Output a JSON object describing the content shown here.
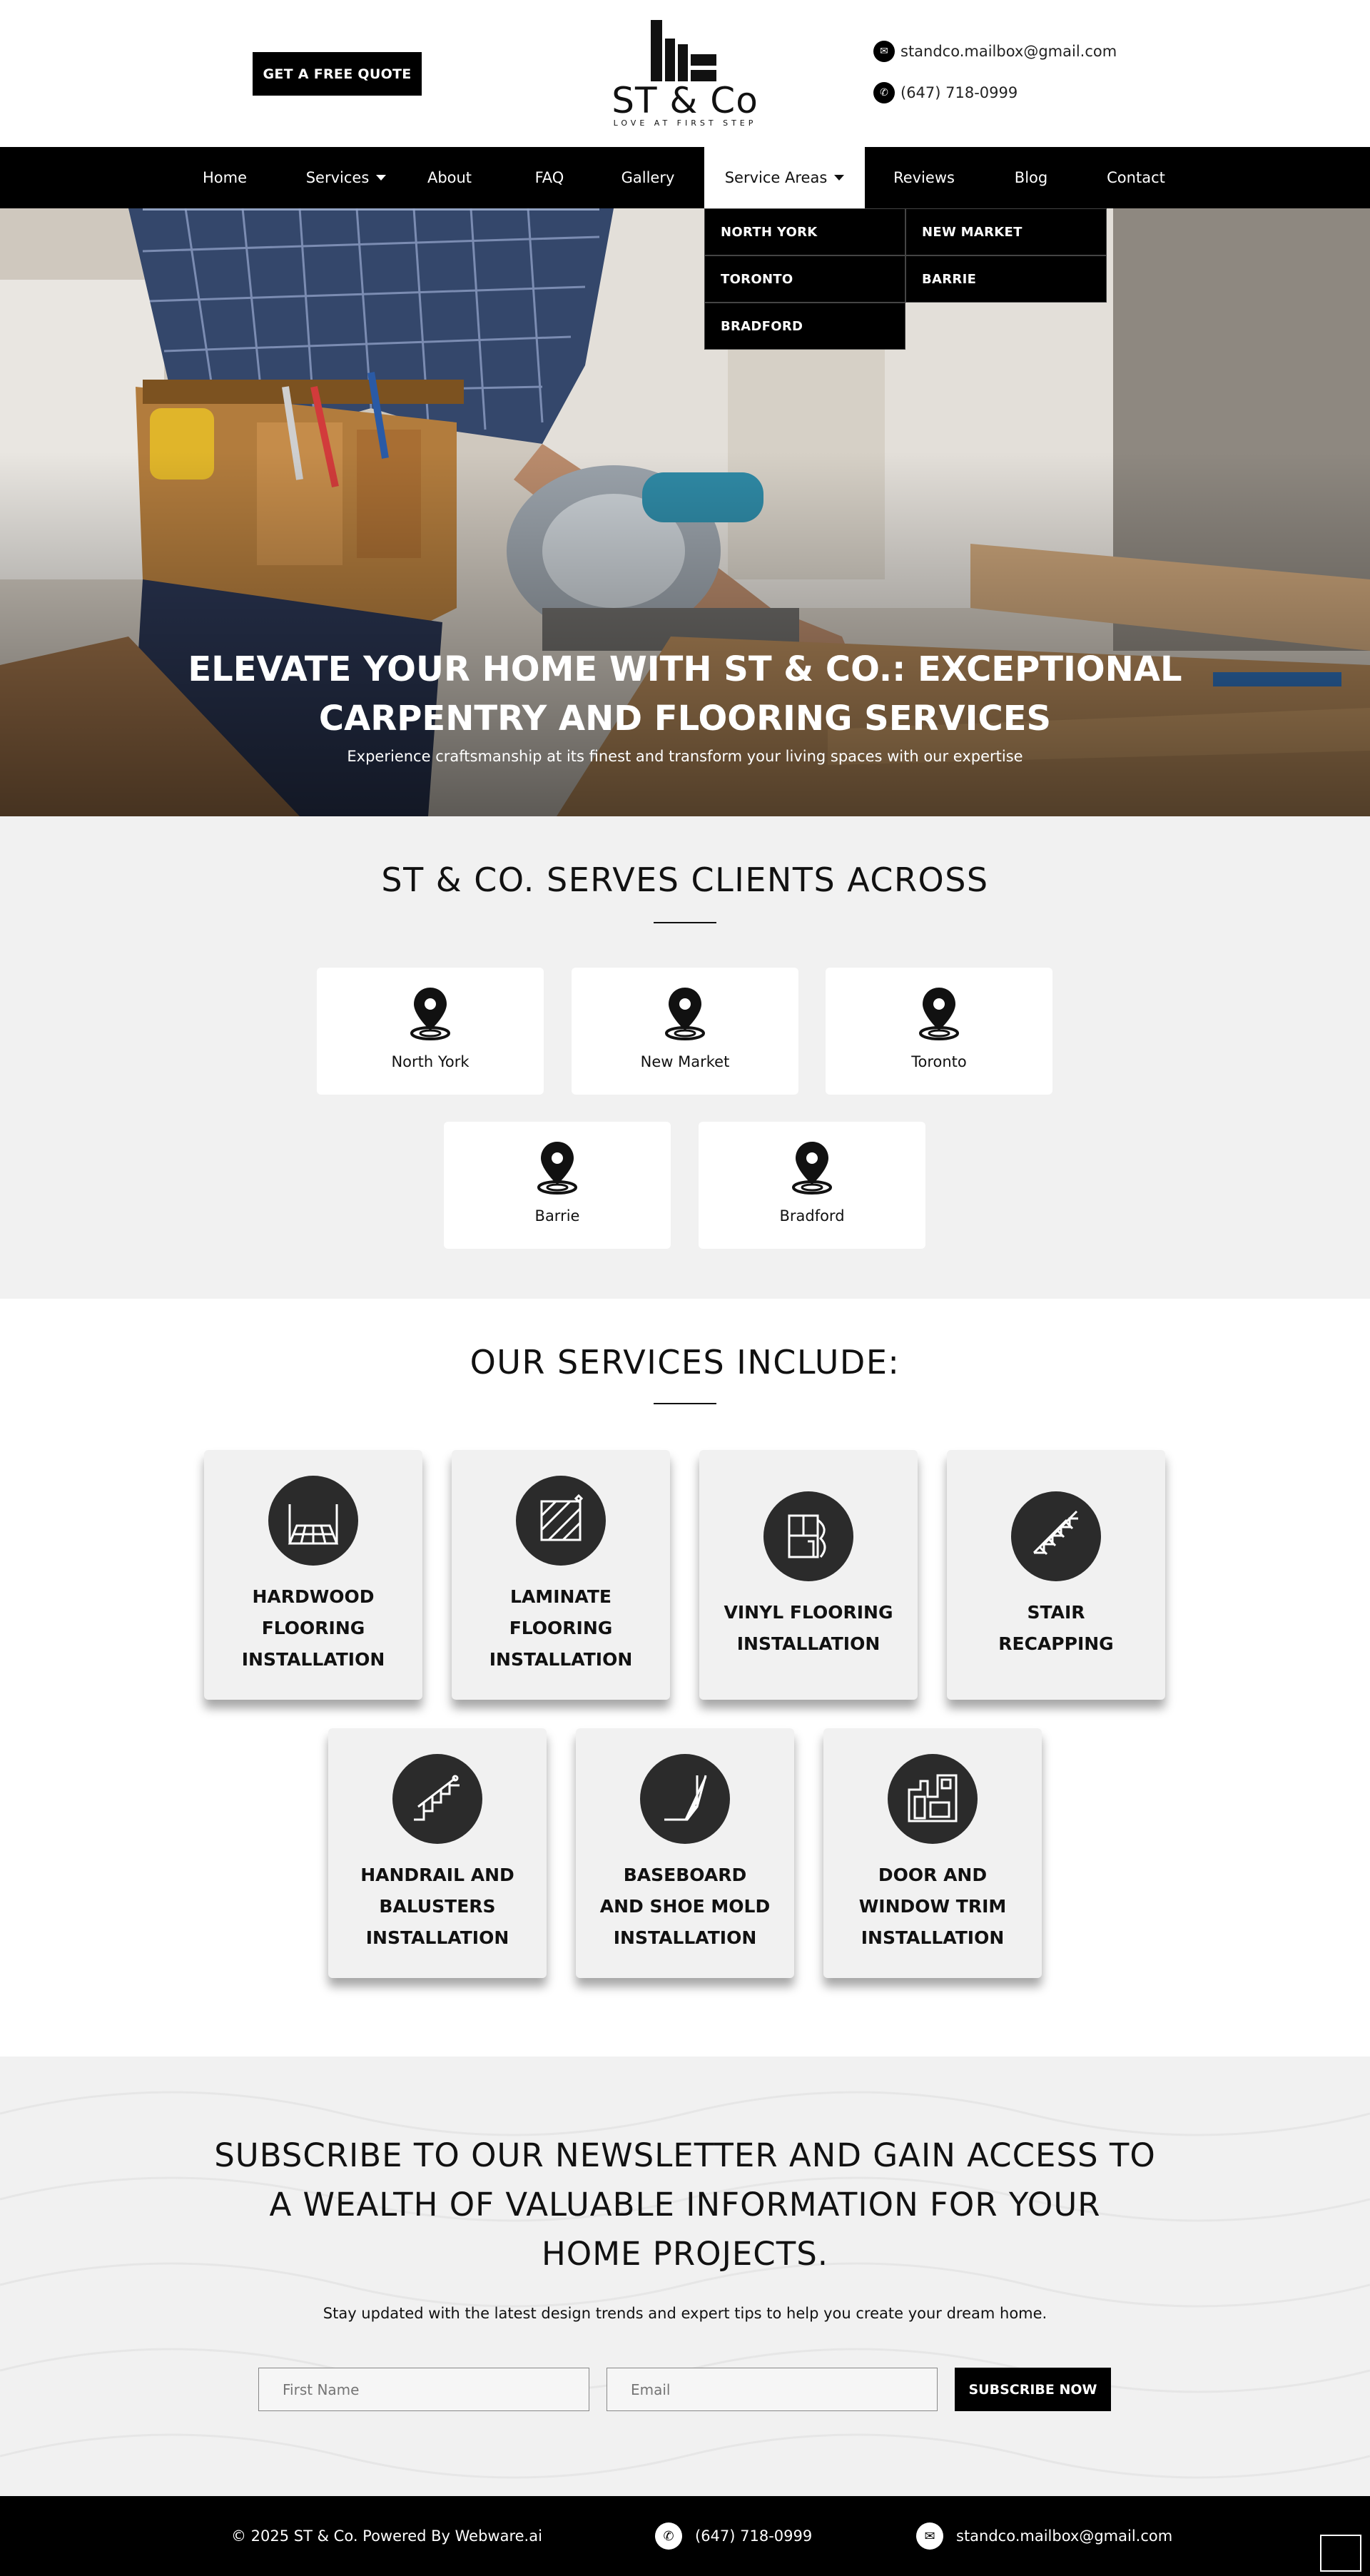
{
  "header": {
    "quote_button": "GET A FREE QUOTE",
    "logo": {
      "name": "ST & Co",
      "tagline": "LOVE AT FIRST STEP"
    },
    "email": "standco.mailbox@gmail.com",
    "phone": "(647) 718-0999"
  },
  "nav": {
    "items": [
      {
        "label": "Home"
      },
      {
        "label": "Services"
      },
      {
        "label": "About"
      },
      {
        "label": "FAQ"
      },
      {
        "label": "Gallery"
      },
      {
        "label": "Service Areas"
      },
      {
        "label": "Reviews"
      },
      {
        "label": "Blog"
      },
      {
        "label": "Contact"
      }
    ],
    "dropdown": [
      "NORTH YORK",
      "NEW MARKET",
      "TORONTO",
      "BARRIE",
      "BRADFORD"
    ]
  },
  "hero": {
    "title": "ELEVATE YOUR HOME WITH ST & CO.: EXCEPTIONAL CARPENTRY AND FLOORING SERVICES",
    "subtitle": "Experience craftsmanship at its finest and transform your living spaces with our expertise"
  },
  "serves": {
    "title": "ST & CO. SERVES CLIENTS ACROSS",
    "areas": [
      "North York",
      "New Market",
      "Toronto",
      "Barrie",
      "Bradford"
    ]
  },
  "services": {
    "title": "OUR SERVICES INCLUDE:",
    "items": [
      {
        "label": "HARDWOOD FLOORING INSTALLATION",
        "icon": "hardwood-floor-icon"
      },
      {
        "label": "LAMINATE FLOORING INSTALLATION",
        "icon": "laminate-icon"
      },
      {
        "label": "VINYL FLOORING INSTALLATION",
        "icon": "vinyl-icon"
      },
      {
        "label": "STAIR RECAPPING",
        "icon": "stairs-icon"
      },
      {
        "label": "HANDRAIL AND BALUSTERS INSTALLATION",
        "icon": "handrail-icon"
      },
      {
        "label": "BASEBOARD AND SHOE MOLD INSTALLATION",
        "icon": "baseboard-icon"
      },
      {
        "label": "DOOR AND WINDOW TRIM INSTALLATION",
        "icon": "door-trim-icon"
      }
    ]
  },
  "newsletter": {
    "title": "SUBSCRIBE TO OUR NEWSLETTER AND GAIN ACCESS TO A WEALTH OF VALUABLE INFORMATION FOR YOUR HOME PROJECTS.",
    "subtitle": "Stay updated with the latest design trends and expert tips to help you create your dream home.",
    "first_name_placeholder": "First Name",
    "email_placeholder": "Email",
    "button": "SUBSCRIBE NOW"
  },
  "footer": {
    "copyright": "© 2025 ST & Co. Powered By Webware.ai",
    "phone": "(647) 718-0999",
    "email": "standco.mailbox@gmail.com"
  }
}
